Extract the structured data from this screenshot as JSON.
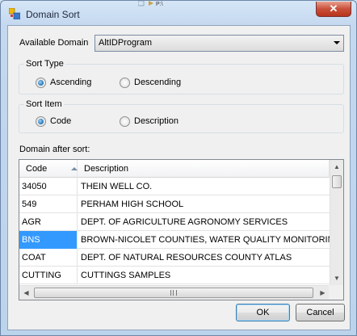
{
  "window": {
    "title": "Domain Sort",
    "close_label": "✕"
  },
  "available_domain": {
    "label": "Available Domain",
    "selected": "AltIDProgram"
  },
  "sort_type": {
    "title": "Sort Type",
    "options": [
      {
        "label": "Ascending",
        "checked": true
      },
      {
        "label": "Descending",
        "checked": false
      }
    ]
  },
  "sort_item": {
    "title": "Sort Item",
    "options": [
      {
        "label": "Code",
        "checked": true
      },
      {
        "label": "Description",
        "checked": false
      }
    ]
  },
  "domain_list": {
    "label": "Domain after sort:",
    "columns": [
      "Code",
      "Description"
    ],
    "rows": [
      {
        "code": "34050",
        "description": "THEIN WELL CO."
      },
      {
        "code": "549",
        "description": "PERHAM HIGH SCHOOL"
      },
      {
        "code": "AGR",
        "description": "DEPT. OF AGRICULTURE AGRONOMY SERVICES"
      },
      {
        "code": "BNS",
        "description": "BROWN-NICOLET COUNTIES, WATER QUALITY MONITORING",
        "selected": true
      },
      {
        "code": "COAT",
        "description": "DEPT. OF NATURAL RESOURCES COUNTY ATLAS"
      },
      {
        "code": "CUTTING",
        "description": "CUTTINGS SAMPLES"
      }
    ]
  },
  "buttons": {
    "ok": "OK",
    "cancel": "Cancel"
  },
  "colors": {
    "selection": "#3399ff",
    "close": "#c8503a"
  }
}
